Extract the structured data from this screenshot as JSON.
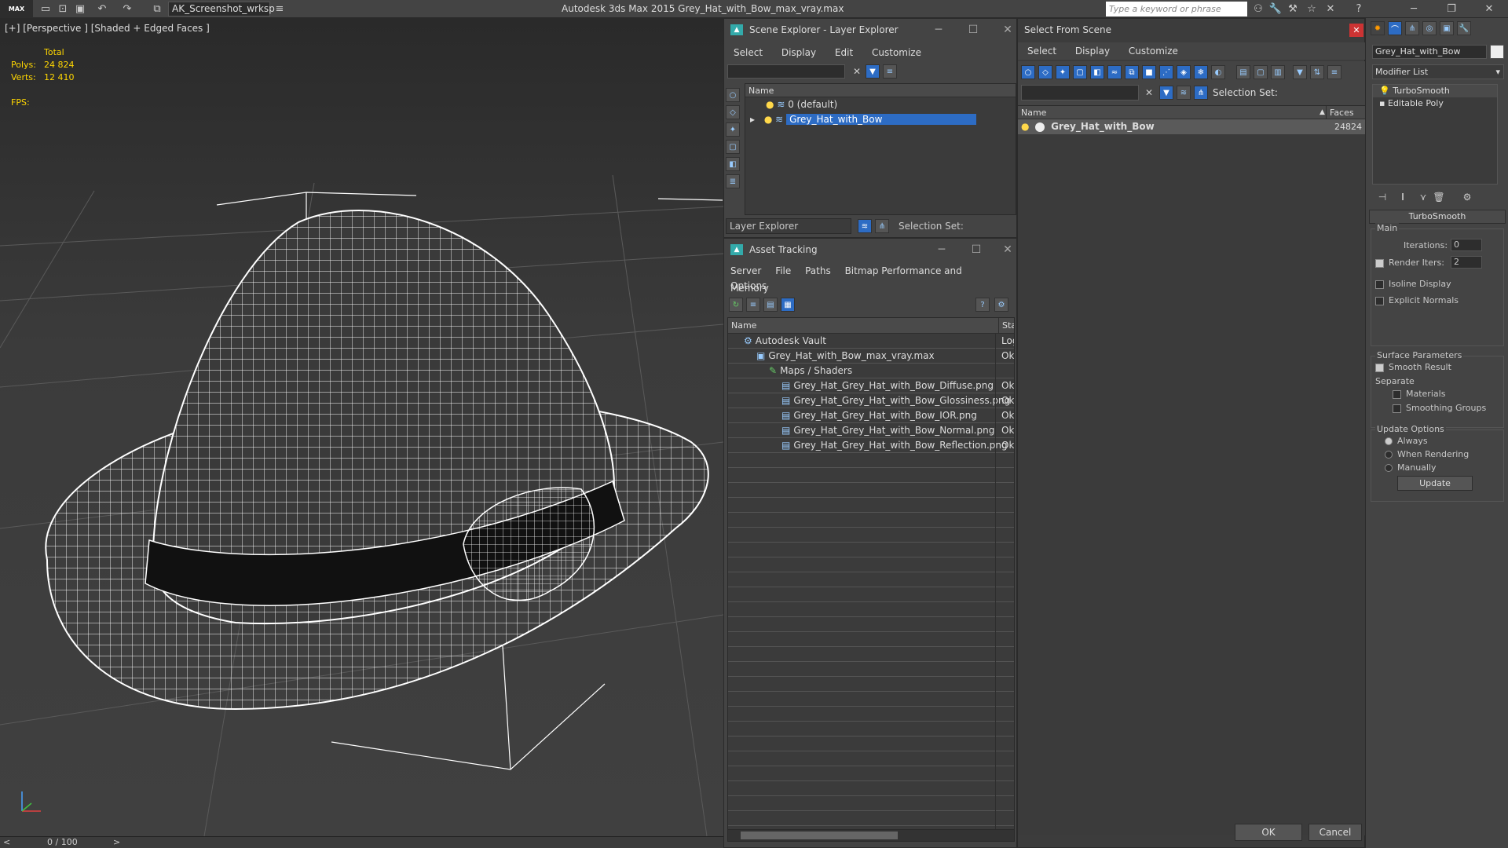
{
  "titlebar": {
    "logo": "MAX",
    "workspace": "AK_Screenshot_wrksp",
    "app_title": "Autodesk 3ds Max  2015    Grey_Hat_with_Bow_max_vray.max",
    "search_placeholder": "Type a keyword or phrase"
  },
  "viewport": {
    "label": "[+] [Perspective ] [Shaded + Edged Faces ]",
    "total_label": "Total",
    "polys_label": "Polys:",
    "polys_value": "24 824",
    "verts_label": "Verts:",
    "verts_value": "12 410",
    "fps_label": "FPS:"
  },
  "timeline": {
    "frame": "0 / 100",
    "prev": "<",
    "next": ">"
  },
  "scene_explorer": {
    "title": "Scene Explorer - Layer Explorer",
    "menu": [
      "Select",
      "Display",
      "Edit",
      "Customize"
    ],
    "col_name": "Name",
    "rows": [
      "0 (default)",
      "Grey_Hat_with_Bow"
    ],
    "footer_dropdown": "Layer Explorer",
    "selection_set": "Selection Set:"
  },
  "asset_tracking": {
    "title": "Asset Tracking",
    "menu1": [
      "Server",
      "File",
      "Paths",
      "Bitmap Performance and Memory"
    ],
    "menu2": [
      "Options"
    ],
    "col_name": "Name",
    "col_status": "Stat",
    "rows": [
      {
        "name": "Autodesk Vault",
        "status": "Log",
        "indent": 0
      },
      {
        "name": "Grey_Hat_with_Bow_max_vray.max",
        "status": "Ok",
        "indent": 1
      },
      {
        "name": "Maps / Shaders",
        "status": "",
        "indent": 2
      },
      {
        "name": "Grey_Hat_Grey_Hat_with_Bow_Diffuse.png",
        "status": "Ok",
        "indent": 3
      },
      {
        "name": "Grey_Hat_Grey_Hat_with_Bow_Glossiness.png",
        "status": "Ok",
        "indent": 3
      },
      {
        "name": "Grey_Hat_Grey_Hat_with_Bow_IOR.png",
        "status": "Ok",
        "indent": 3
      },
      {
        "name": "Grey_Hat_Grey_Hat_with_Bow_Normal.png",
        "status": "Ok",
        "indent": 3
      },
      {
        "name": "Grey_Hat_Grey_Hat_with_Bow_Reflection.png",
        "status": "Ok",
        "indent": 3
      }
    ]
  },
  "select_from_scene": {
    "title": "Select From Scene",
    "menu": [
      "Select",
      "Display",
      "Customize"
    ],
    "selection_set": "Selection Set:",
    "col_name": "Name",
    "col_faces": "Faces",
    "row_name": "Grey_Hat_with_Bow",
    "row_faces": "24824",
    "ok": "OK",
    "cancel": "Cancel"
  },
  "command_panel": {
    "object_name": "Grey_Hat_with_Bow",
    "modifier_list": "Modifier List",
    "stack": [
      "TurboSmooth",
      "Editable Poly"
    ],
    "rollout_title": "TurboSmooth",
    "main_group": "Main",
    "iterations_label": "Iterations:",
    "iterations_value": "0",
    "render_iters_label": "Render Iters:",
    "render_iters_value": "2",
    "isoline": "Isoline Display",
    "explicit_normals": "Explicit Normals",
    "surface_group": "Surface Parameters",
    "smooth_result": "Smooth Result",
    "separate": "Separate",
    "materials": "Materials",
    "smoothing_groups": "Smoothing Groups",
    "update_group": "Update Options",
    "always": "Always",
    "when_rendering": "When Rendering",
    "manually": "Manually",
    "update_btn": "Update"
  }
}
